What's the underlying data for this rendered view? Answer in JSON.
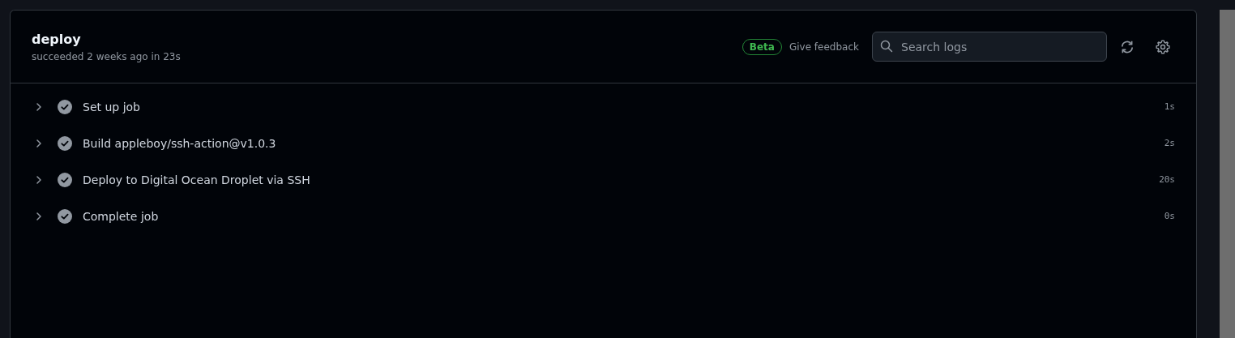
{
  "job": {
    "title": "deploy",
    "summary": "succeeded 2 weeks ago in 23s"
  },
  "toolbar": {
    "badge": "Beta",
    "feedback_link": "Give feedback",
    "search": {
      "placeholder": "Search logs"
    }
  },
  "steps": [
    {
      "name": "Set up job",
      "kind": "success",
      "expanded": false,
      "duration": "1s"
    },
    {
      "name": "Build appleboy/ssh-action@v1.0.3",
      "kind": "success",
      "expanded": false,
      "duration": "2s"
    },
    {
      "name": "Deploy to Digital Ocean Droplet via SSH",
      "kind": "success",
      "expanded": false,
      "duration": "20s"
    },
    {
      "name": "Complete job",
      "kind": "success",
      "expanded": false,
      "duration": "0s"
    }
  ]
}
